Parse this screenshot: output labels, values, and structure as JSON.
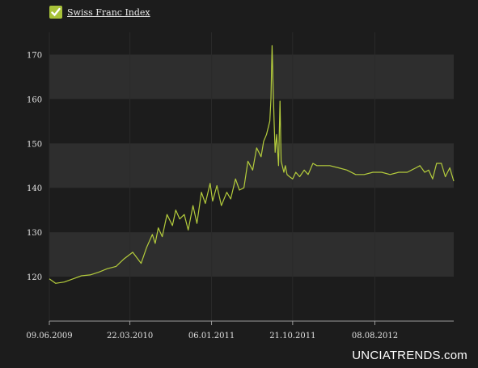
{
  "legend": {
    "label": "Swiss Franc Index",
    "checked": true
  },
  "watermark": "UNCIATRENDS.com",
  "colors": {
    "background": "#1c1c1c",
    "band": "#2e2e2e",
    "line": "#b4cc3c",
    "text": "#e0e0e0"
  },
  "chart_data": {
    "type": "line",
    "title": "",
    "xlabel": "",
    "ylabel": "",
    "legend_position": "top-left",
    "grid": true,
    "ylim": [
      110,
      175
    ],
    "xlim": [
      "2009-06-09",
      "2013-05-15"
    ],
    "y_ticks": [
      120,
      130,
      140,
      150,
      160,
      170
    ],
    "x_ticks": [
      "09.06.2009",
      "22.03.2010",
      "06.01.2011",
      "21.10.2011",
      "08.08.2012"
    ],
    "x_tick_dates": [
      "2009-06-09",
      "2010-03-22",
      "2011-01-06",
      "2011-10-21",
      "2012-08-08"
    ],
    "series": [
      {
        "name": "Swiss Franc Index",
        "x": [
          "2009-06-09",
          "2009-07-01",
          "2009-08-01",
          "2009-09-01",
          "2009-10-01",
          "2009-11-01",
          "2009-12-01",
          "2010-01-01",
          "2010-02-01",
          "2010-03-01",
          "2010-04-01",
          "2010-05-01",
          "2010-05-20",
          "2010-06-10",
          "2010-06-20",
          "2010-07-01",
          "2010-07-15",
          "2010-08-01",
          "2010-08-20",
          "2010-09-01",
          "2010-09-15",
          "2010-10-01",
          "2010-10-15",
          "2010-11-01",
          "2010-11-15",
          "2010-12-01",
          "2010-12-15",
          "2011-01-01",
          "2011-01-10",
          "2011-01-25",
          "2011-02-10",
          "2011-03-01",
          "2011-03-15",
          "2011-04-01",
          "2011-04-15",
          "2011-05-01",
          "2011-05-15",
          "2011-06-01",
          "2011-06-15",
          "2011-07-01",
          "2011-07-10",
          "2011-07-20",
          "2011-08-01",
          "2011-08-05",
          "2011-08-09",
          "2011-08-12",
          "2011-08-16",
          "2011-08-20",
          "2011-08-25",
          "2011-09-01",
          "2011-09-06",
          "2011-09-10",
          "2011-09-20",
          "2011-09-25",
          "2011-10-01",
          "2011-10-10",
          "2011-10-21",
          "2011-11-01",
          "2011-11-15",
          "2011-12-01",
          "2011-12-15",
          "2012-01-01",
          "2012-01-15",
          "2012-02-01",
          "2012-03-01",
          "2012-04-01",
          "2012-05-01",
          "2012-06-01",
          "2012-07-01",
          "2012-08-01",
          "2012-09-01",
          "2012-10-01",
          "2012-11-01",
          "2012-12-01",
          "2013-01-01",
          "2013-01-15",
          "2013-02-01",
          "2013-02-15",
          "2013-03-01",
          "2013-03-15",
          "2013-04-01",
          "2013-04-15",
          "2013-05-01",
          "2013-05-15"
        ],
        "y": [
          119.5,
          118.5,
          118.8,
          119.5,
          120.2,
          120.4,
          121.0,
          121.8,
          122.3,
          124.0,
          125.5,
          123.0,
          126.5,
          129.5,
          127.5,
          131.0,
          129.0,
          134.0,
          131.5,
          135.0,
          133.0,
          134.0,
          130.5,
          136.0,
          132.0,
          139.0,
          136.5,
          141.0,
          137.0,
          140.5,
          136.0,
          139.0,
          137.5,
          142.0,
          139.5,
          140.0,
          146.0,
          144.0,
          149.0,
          147.0,
          150.5,
          152.0,
          155.0,
          160.0,
          172.0,
          164.0,
          155.0,
          148.0,
          152.0,
          145.0,
          159.5,
          146.0,
          143.5,
          145.0,
          143.0,
          142.5,
          142.0,
          143.5,
          142.5,
          144.0,
          143.0,
          145.5,
          145.0,
          145.0,
          145.0,
          144.5,
          144.0,
          143.0,
          143.0,
          143.5,
          143.5,
          143.0,
          143.5,
          143.5,
          144.5,
          145.0,
          143.5,
          144.0,
          142.0,
          145.5,
          145.5,
          142.5,
          144.5,
          141.5
        ]
      }
    ]
  }
}
